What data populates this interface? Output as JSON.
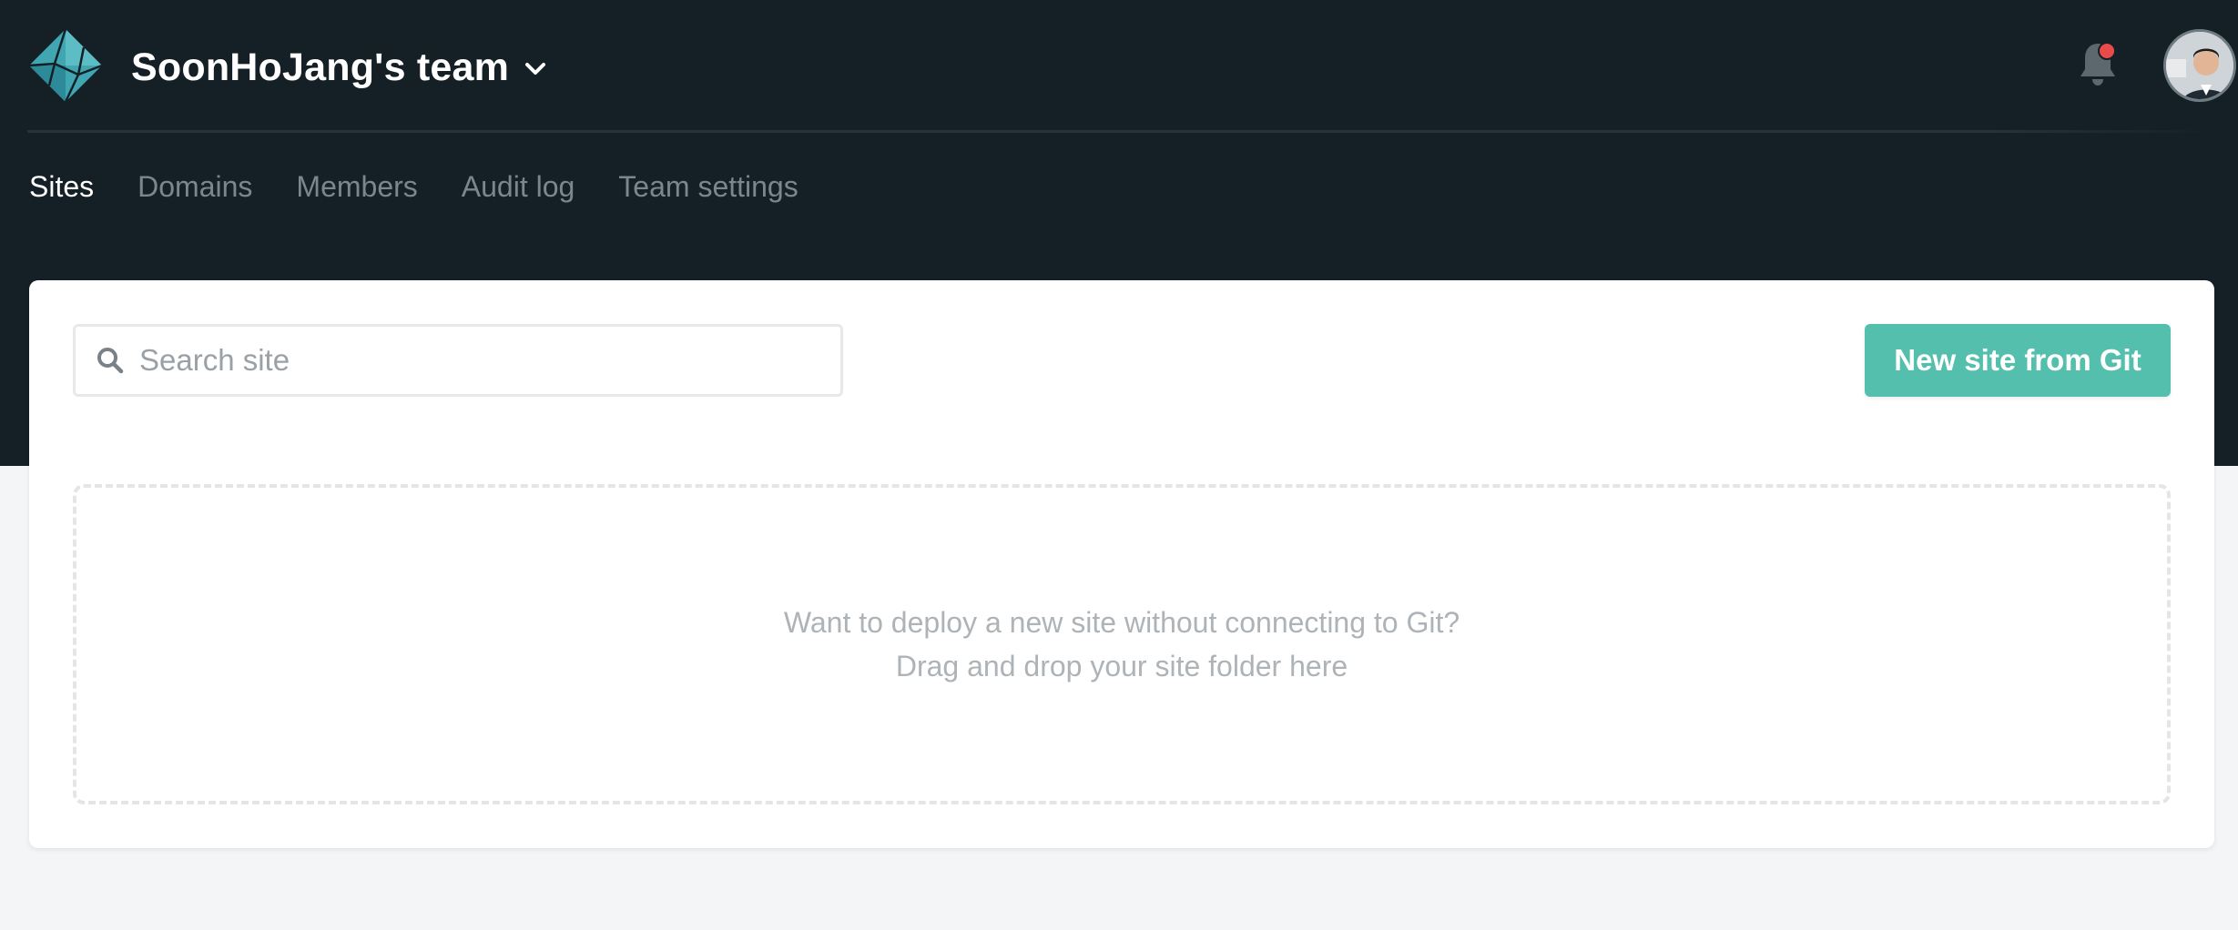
{
  "header": {
    "team_name": "SoonHoJang's team",
    "notification_indicator": "red-dot"
  },
  "nav": {
    "items": [
      {
        "label": "Sites",
        "active": true
      },
      {
        "label": "Domains",
        "active": false
      },
      {
        "label": "Members",
        "active": false
      },
      {
        "label": "Audit log",
        "active": false
      },
      {
        "label": "Team settings",
        "active": false
      }
    ]
  },
  "search": {
    "placeholder": "Search site",
    "value": ""
  },
  "actions": {
    "new_site_label": "New site from Git"
  },
  "dropzone": {
    "line1": "Want to deploy a new site without connecting to Git?",
    "line2": "Drag and drop your site folder here"
  },
  "colors": {
    "header_bg": "#142026",
    "accent": "#55bfad",
    "notification": "#e94b4b",
    "page_bg": "#f4f5f7"
  }
}
